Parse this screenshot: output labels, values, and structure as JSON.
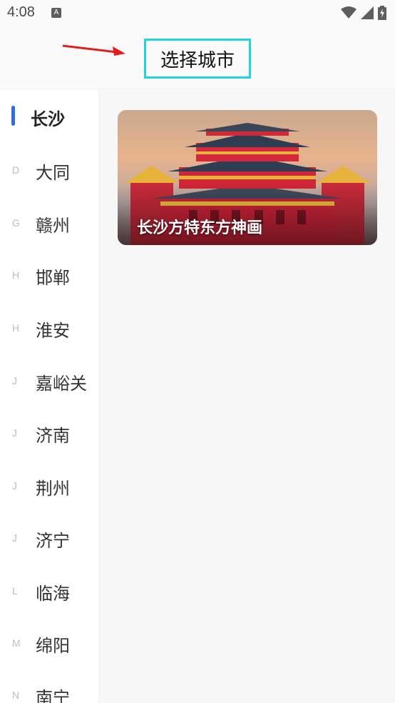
{
  "status_bar": {
    "time": "4:08",
    "notification_badge": "A",
    "icons": [
      "wifi-icon",
      "signal-icon",
      "battery-charging-icon"
    ]
  },
  "header": {
    "title": "选择城市"
  },
  "sidebar": {
    "active_city": "长沙",
    "cities": [
      {
        "letter": "D",
        "name": "大同"
      },
      {
        "letter": "G",
        "name": "赣州"
      },
      {
        "letter": "H",
        "name": "邯郸"
      },
      {
        "letter": "H",
        "name": "淮安"
      },
      {
        "letter": "J",
        "name": "嘉峪关"
      },
      {
        "letter": "J",
        "name": "济南"
      },
      {
        "letter": "J",
        "name": "荆州"
      },
      {
        "letter": "J",
        "name": "济宁"
      },
      {
        "letter": "L",
        "name": "临海"
      },
      {
        "letter": "M",
        "name": "绵阳"
      },
      {
        "letter": "N",
        "name": "南宁"
      }
    ]
  },
  "main": {
    "banner": {
      "label": "长沙方特东方神画"
    }
  },
  "colors": {
    "accent": "#2f6de0",
    "highlight_box": "#22d3df",
    "arrow": "#e02020"
  }
}
